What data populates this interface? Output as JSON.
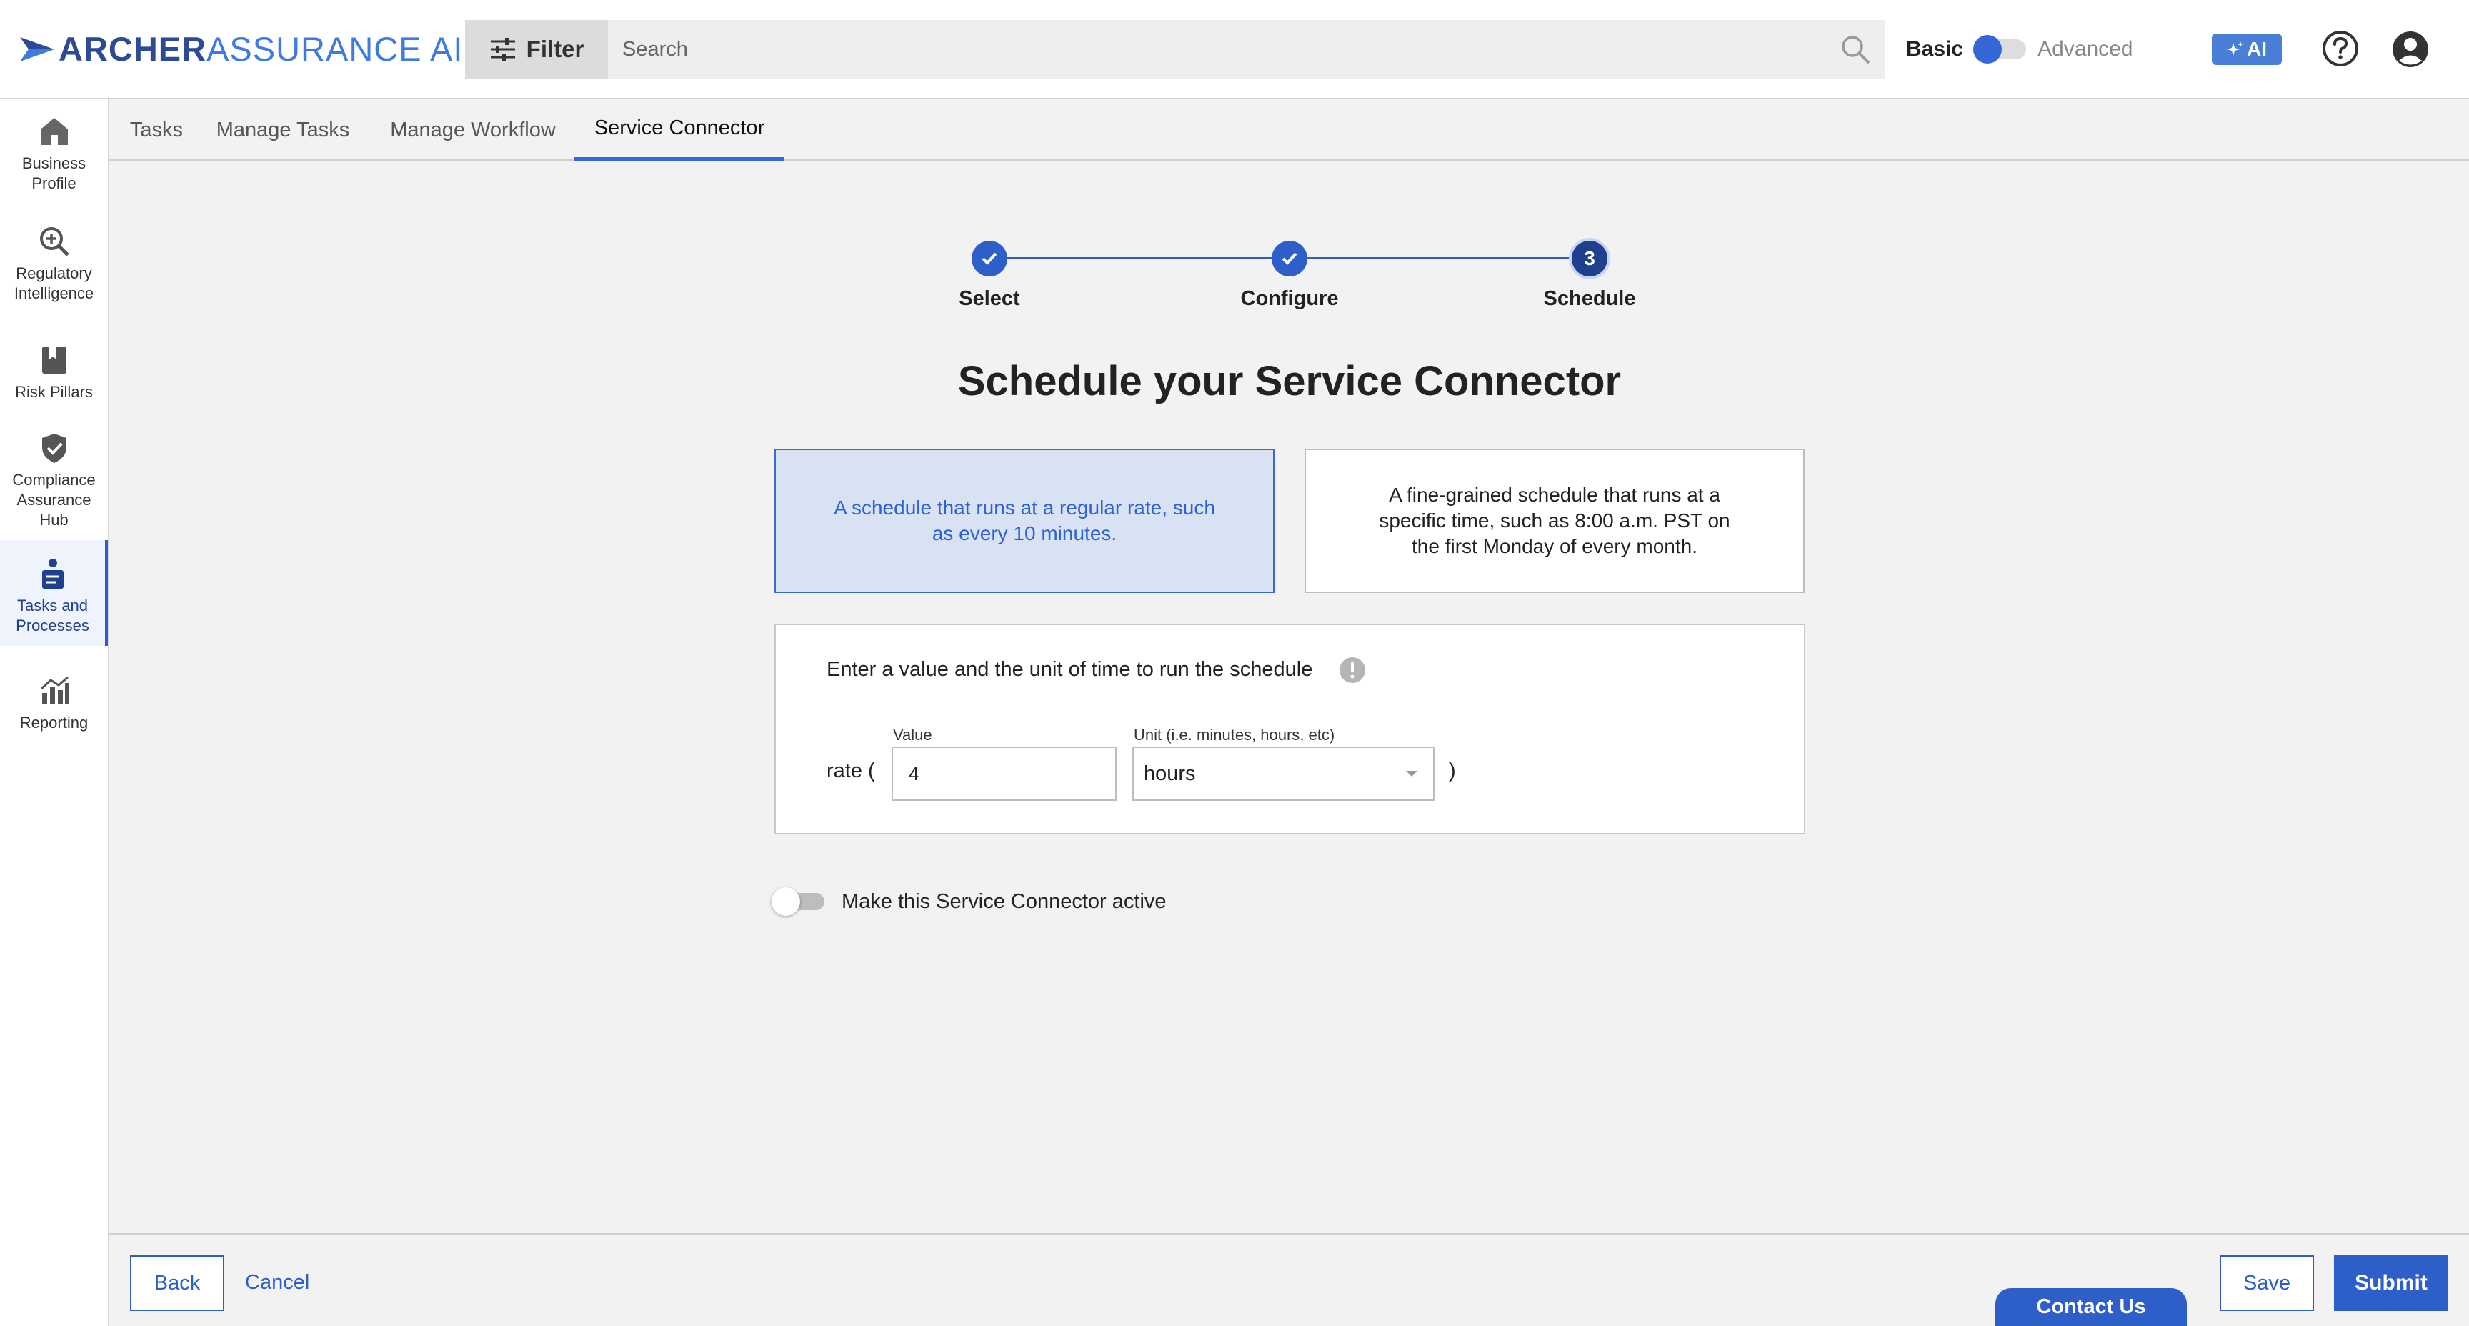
{
  "brand": {
    "name_strong": "ARCHER",
    "name_light": "ASSURANCE AI",
    "primary_color": "#2e5fc9",
    "accent_color": "#3e7be0"
  },
  "header": {
    "filter_label": "Filter",
    "search_placeholder": "Search",
    "mode_basic": "Basic",
    "mode_advanced": "Advanced",
    "ai_label": "AI",
    "icons": [
      "filter-icon",
      "search-icon",
      "sparkle-icon",
      "help-icon",
      "user-icon"
    ]
  },
  "sidebar": {
    "items": [
      {
        "label_line1": "Business",
        "label_line2": "Profile",
        "label_line3": "",
        "icon": "home-icon"
      },
      {
        "label_line1": "Regulatory",
        "label_line2": "Intelligence",
        "label_line3": "",
        "icon": "magnify-plus-icon"
      },
      {
        "label_line1": "Risk Pillars",
        "label_line2": "",
        "label_line3": "",
        "icon": "bookmark-icon"
      },
      {
        "label_line1": "Compliance",
        "label_line2": "Assurance",
        "label_line3": "Hub",
        "icon": "shield-check-icon"
      },
      {
        "label_line1": "Tasks and",
        "label_line2": "Processes",
        "label_line3": "",
        "icon": "tasks-icon",
        "active": true
      },
      {
        "label_line1": "Reporting",
        "label_line2": "",
        "label_line3": "",
        "icon": "chart-icon"
      }
    ]
  },
  "tabs": [
    "Tasks",
    "Manage Tasks",
    "Manage Workflow",
    "Service Connector"
  ],
  "active_tab": "Service Connector",
  "stepper": {
    "steps": [
      {
        "label": "Select",
        "status": "complete"
      },
      {
        "label": "Configure",
        "status": "complete"
      },
      {
        "label": "Schedule",
        "status": "current",
        "number": "3"
      }
    ]
  },
  "main": {
    "title": "Schedule your Service Connector",
    "option_rate": "A schedule that runs at a regular rate, such as every 10 minutes.",
    "option_cron": "A fine-grained schedule that runs at a specific time, such as 8:00 a.m. PST on the first Monday of every month.",
    "selected_option": "rate",
    "rate_help": "Enter a value and the unit of time to run the schedule",
    "rate_prefix": "rate (",
    "rate_suffix": ")",
    "value_label": "Value",
    "value": "4",
    "unit_label": "Unit (i.e. minutes, hours, etc)",
    "unit_value": "hours",
    "active_toggle_label": "Make this Service Connector active",
    "active": false
  },
  "footer": {
    "back": "Back",
    "cancel": "Cancel",
    "contact": "Contact Us",
    "save": "Save",
    "submit": "Submit"
  }
}
